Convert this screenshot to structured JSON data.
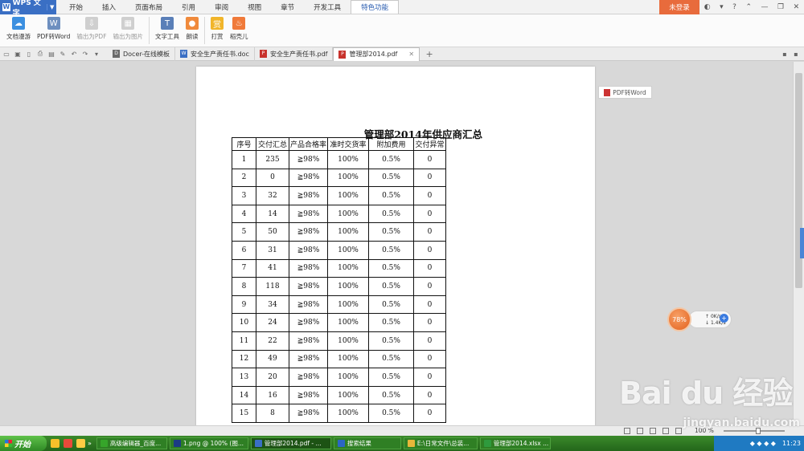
{
  "app": {
    "name": "WPS 文字",
    "logo_glyph": "W",
    "login_label": "未登录",
    "accent_color": "#3a6fc4",
    "login_color": "#e86b3c"
  },
  "menu": {
    "tabs": [
      "开始",
      "插入",
      "页面布局",
      "引用",
      "审阅",
      "视图",
      "章节",
      "开发工具",
      "特色功能"
    ],
    "active_index": 8
  },
  "ribbon": {
    "buttons": [
      {
        "label": "文档漫游",
        "icon": "cloud-icon",
        "disabled": false
      },
      {
        "label": "PDF转Word",
        "icon": "pdf-word-icon",
        "disabled": false
      },
      {
        "label": "输出为PDF",
        "icon": "export-pdf-icon",
        "disabled": true
      },
      {
        "label": "输出为图片",
        "icon": "export-image-icon",
        "disabled": true
      },
      {
        "label": "文字工具",
        "icon": "text-tools-icon",
        "disabled": false
      },
      {
        "label": "朗读",
        "icon": "microphone-icon",
        "disabled": false
      },
      {
        "label": "打赏",
        "icon": "reward-icon",
        "disabled": false
      },
      {
        "label": "稻壳儿",
        "icon": "docer-icon",
        "disabled": false
      }
    ]
  },
  "doc_tabs": [
    {
      "label": "Docer-在线模板",
      "type": "docer",
      "active": false
    },
    {
      "label": "安全生产责任书.doc",
      "type": "doc",
      "active": false
    },
    {
      "label": "安全生产责任书.pdf",
      "type": "pdf",
      "active": false
    },
    {
      "label": "管理部2014.pdf",
      "type": "pdf",
      "active": true
    }
  ],
  "document": {
    "title": "管理部2014年供应商汇总",
    "columns": [
      "序号",
      "交付汇总",
      "产品合格率",
      "准时交货率",
      "附加费用",
      "交付异常"
    ],
    "rows": [
      [
        "1",
        "235",
        "≧98%",
        "100%",
        "0.5%",
        "0"
      ],
      [
        "2",
        "0",
        "≧98%",
        "100%",
        "0.5%",
        "0"
      ],
      [
        "3",
        "32",
        "≧98%",
        "100%",
        "0.5%",
        "0"
      ],
      [
        "4",
        "14",
        "≧98%",
        "100%",
        "0.5%",
        "0"
      ],
      [
        "5",
        "50",
        "≧98%",
        "100%",
        "0.5%",
        "0"
      ],
      [
        "6",
        "31",
        "≧98%",
        "100%",
        "0.5%",
        "0"
      ],
      [
        "7",
        "41",
        "≧98%",
        "100%",
        "0.5%",
        "0"
      ],
      [
        "8",
        "118",
        "≧98%",
        "100%",
        "0.5%",
        "0"
      ],
      [
        "9",
        "34",
        "≧98%",
        "100%",
        "0.5%",
        "0"
      ],
      [
        "10",
        "24",
        "≧98%",
        "100%",
        "0.5%",
        "0"
      ],
      [
        "11",
        "22",
        "≧98%",
        "100%",
        "0.5%",
        "0"
      ],
      [
        "12",
        "49",
        "≧98%",
        "100%",
        "0.5%",
        "0"
      ],
      [
        "13",
        "20",
        "≧98%",
        "100%",
        "0.5%",
        "0"
      ],
      [
        "14",
        "16",
        "≧98%",
        "100%",
        "0.5%",
        "0"
      ],
      [
        "15",
        "8",
        "≧98%",
        "100%",
        "0.5%",
        "0"
      ]
    ]
  },
  "float": {
    "pdf_to_word_label": "PDF转Word"
  },
  "net_widget": {
    "percent": "78%",
    "up_speed": "0K/s",
    "down_speed": "1.4K/s"
  },
  "status": {
    "zoom": "100 %"
  },
  "watermark": {
    "logo_text": "Bai du 经验",
    "site": "jingyan.baidu.com"
  },
  "taskbar": {
    "start_label": "开始",
    "tasks": [
      {
        "label": "高级编辑器_百度...",
        "color": "#36a52a",
        "active": false
      },
      {
        "label": "1.png @ 100% (图...",
        "color": "#1b3c84",
        "active": false
      },
      {
        "label": "管理部2014.pdf - ...",
        "color": "#3a6fc4",
        "active": true
      },
      {
        "label": "搜索结果",
        "color": "#2b66c4",
        "active": false
      },
      {
        "label": "E:\\日常文件\\总装...",
        "color": "#e7b73a",
        "active": false
      },
      {
        "label": "管理部2014.xlsx ...",
        "color": "#2f9a3d",
        "active": false
      }
    ],
    "clock": "11:23"
  }
}
